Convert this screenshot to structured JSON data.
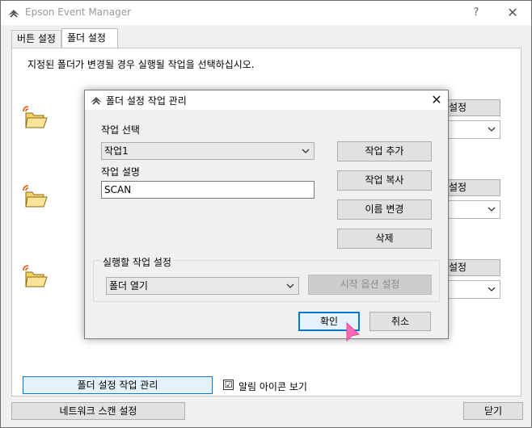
{
  "main": {
    "title": "Epson Event Manager",
    "help": "?",
    "close": "✕",
    "tabs": [
      {
        "label": "버튼 설정"
      },
      {
        "label": "폴더 설정"
      }
    ],
    "description": "지정된 폴더가 변경될 경우 실행될 작업을 선택하십시오.",
    "folder_rows": [
      {
        "button_partial": "설정"
      },
      {
        "button_partial": "설정"
      },
      {
        "button_partial": "설정"
      }
    ],
    "manage_button": "폴더 설정 작업 관리",
    "alert_icon_check": "☑",
    "alert_icon_label": "알림 아이콘 보기",
    "network_scan_button": "네트워크 스캔 설정",
    "close_button": "닫기"
  },
  "dialog": {
    "title": "폴더 설정 작업 관리",
    "close": "✕",
    "task_select_label": "작업 선택",
    "task_select_value": "작업1",
    "task_desc_label": "작업 설명",
    "task_desc_value": "SCAN",
    "add_task": "작업 추가",
    "copy_task": "작업 복사",
    "rename": "이름 변경",
    "delete": "삭제",
    "run_group_title": "실행할 작업 설정",
    "run_action_value": "폴더 열기",
    "start_options": "시작 옵션 설정",
    "ok": "확인",
    "cancel": "취소"
  },
  "colors": {
    "accent": "#0078d7",
    "cursor": "#ff69b4"
  }
}
